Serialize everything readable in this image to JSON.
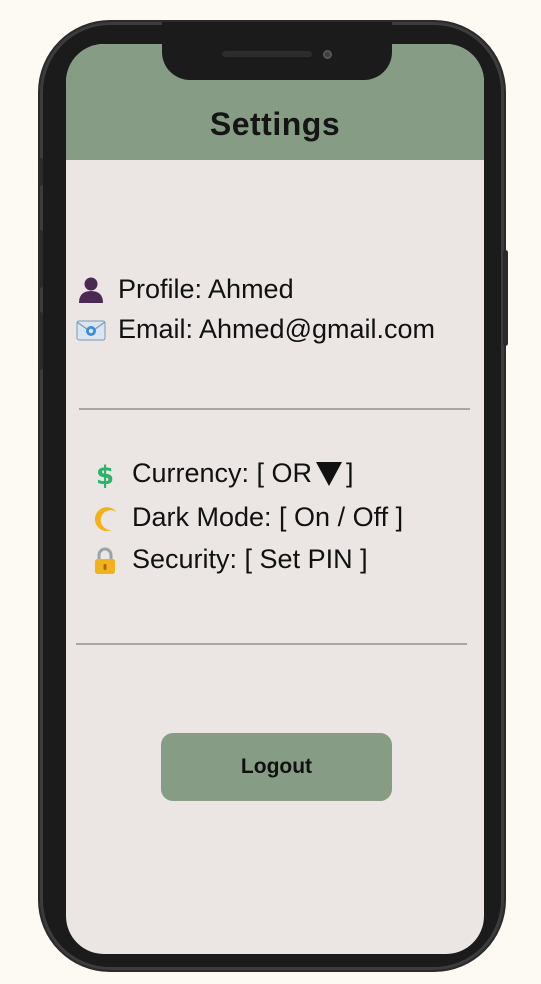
{
  "header": {
    "title": "Settings"
  },
  "profile": {
    "name_label": "Profile: Ahmed",
    "email_label": "Email: Ahmed@gmail.com"
  },
  "preferences": {
    "currency_label": "Currency: [ OR",
    "currency_suffix": "]",
    "dark_mode_label": "Dark Mode: [ On / Off ]",
    "security_label": "Security: [ Set PIN ]"
  },
  "actions": {
    "logout_label": "Logout"
  },
  "icons": {
    "profile": "person-icon",
    "email": "envelope-icon",
    "currency": "dollar-icon",
    "dark_mode": "moon-icon",
    "security": "lock-icon",
    "currency_dropdown": "triangle-down-icon"
  },
  "colors": {
    "accent": "#869c85",
    "screen_bg": "#ebe6e4",
    "frame": "#1b1b1b"
  }
}
